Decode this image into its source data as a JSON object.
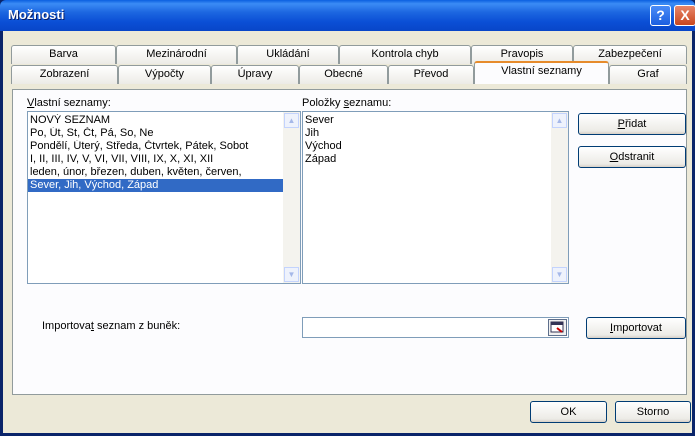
{
  "window": {
    "title": "Možnosti",
    "help_glyph": "?",
    "close_glyph": "X"
  },
  "tabs_row1": [
    "Barva",
    "Mezinárodní",
    "Ukládání",
    "Kontrola chyb",
    "Pravopis",
    "Zabezpečení"
  ],
  "tabs_row2": [
    "Zobrazení",
    "Výpočty",
    "Úpravy",
    "Obecné",
    "Převod",
    "Vlastní seznamy",
    "Graf"
  ],
  "active_tab": "Vlastní seznamy",
  "custom_lists": {
    "label": "Vlastní seznamy:",
    "items": [
      "NOVÝ SEZNAM",
      "Po, Út, St, Čt, Pá, So, Ne",
      "Pondělí, Úterý, Středa, Čtvrtek, Pátek, Sobot",
      "I, II, III, IV, V, VI, VII, VIII, IX, X, XI, XII",
      "leden, únor, březen, duben, květen, červen,",
      "Sever, Jih, Východ, Západ"
    ],
    "selected_index": 5
  },
  "list_entries": {
    "label": "Položky seznamu:",
    "items": [
      "Sever",
      "Jih",
      "Východ",
      "Západ"
    ]
  },
  "buttons": {
    "add": "Přidat",
    "delete": "Odstranit",
    "import": "Importovat",
    "ok": "OK",
    "cancel": "Storno"
  },
  "import": {
    "label": "Importovat seznam z buněk:",
    "value": ""
  },
  "colors": {
    "accent_tab": "#e68b2c",
    "selection": "#316ac5",
    "titlebar": "#0b4fd6"
  }
}
